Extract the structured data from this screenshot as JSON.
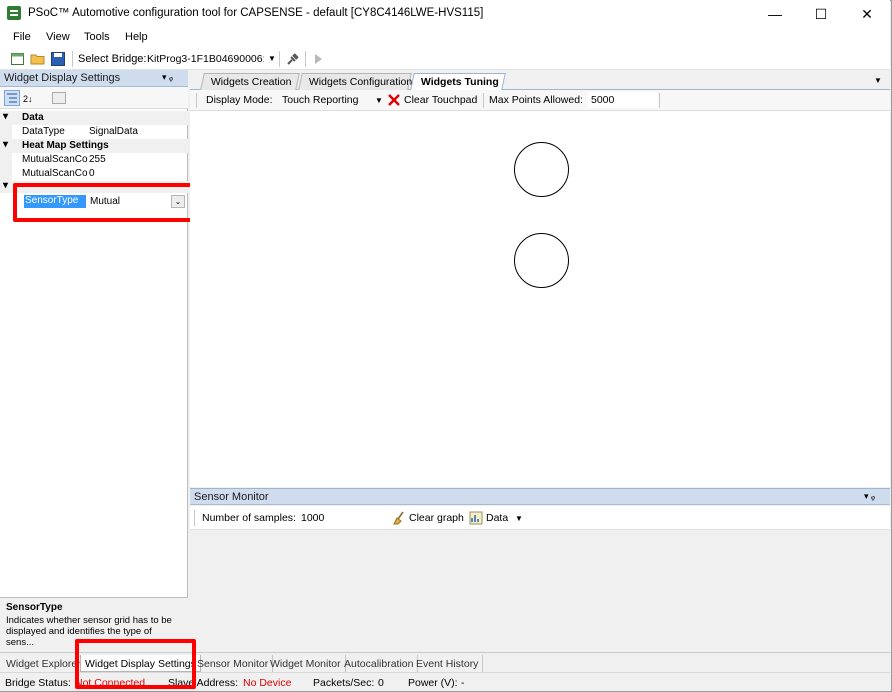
{
  "window": {
    "title": "PSoC™ Automotive configuration tool for CAPSENSE - default [CY8C4146LWE-HVS115]",
    "minimize": "—",
    "maximize": "☐",
    "close": "✕"
  },
  "menu": [
    "File",
    "View",
    "Tools",
    "Help"
  ],
  "toolbar": {
    "select_bridge_label": "Select Bridge:",
    "bridge_value": "KitProg3-1F1B04690006:"
  },
  "left_panel": {
    "title": "Widget Display Settings",
    "pin": "▾ ᵩ",
    "categories": [
      {
        "name": "Data",
        "props": [
          {
            "key": "DataType",
            "value": "SignalData"
          }
        ]
      },
      {
        "name": "Heat Map Settings",
        "props": [
          {
            "key": "MutualScanCo",
            "value": "255"
          },
          {
            "key": "MutualScanCo",
            "value": "0"
          }
        ]
      }
    ],
    "selected_prop": {
      "key": "SensorType",
      "value": "Mutual"
    },
    "description_title": "SensorType",
    "description_text": "Indicates whether sensor grid has to be displayed and identifies the type of sens..."
  },
  "doc_tabs": [
    "Widgets Creation",
    "Widgets Configuration",
    "Widgets Tuning"
  ],
  "tuning_bar": {
    "display_mode_label": "Display Mode:",
    "display_mode_value": "Touch Reporting",
    "clear_touchpad": "Clear Touchpad",
    "max_points_label": "Max Points Allowed:",
    "max_points_value": "5000"
  },
  "sensor_monitor": {
    "title": "Sensor Monitor",
    "samples_label": "Number of samples:",
    "samples_value": "1000",
    "clear_graph": "Clear graph",
    "data_label": "Data"
  },
  "bottom_tabs": [
    "Widget Explorer",
    "Widget Display Settings",
    "Sensor Monitor",
    "Widget Monitor",
    "Autocalibration",
    "Event History"
  ],
  "status": {
    "bridge_status_label": "Bridge Status:",
    "bridge_status_value": "Not Connected",
    "slave_address_label": "Slave Address:",
    "slave_address_value": "No Device",
    "packets_label": "Packets/Sec:",
    "packets_value": "0",
    "power_label": "Power (V):",
    "power_value": "-"
  },
  "colors": {
    "highlight": "#ff0000",
    "panel_header": "#cfdcee",
    "selection": "#3399ff",
    "status_red": "#e00000"
  }
}
